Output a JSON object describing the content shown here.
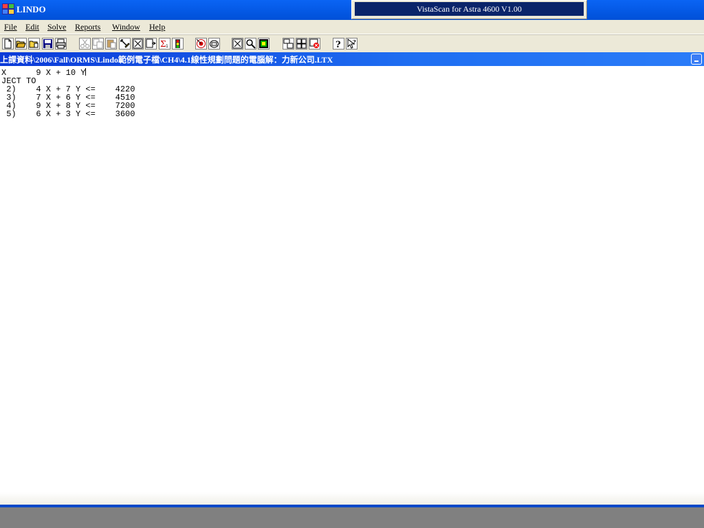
{
  "app": {
    "title": "LINDO"
  },
  "vistascan_window": {
    "title": "VistaScan for Astra 4600 V1.00"
  },
  "menu": [
    {
      "id": "file",
      "label": "File"
    },
    {
      "id": "edit",
      "label": "Edit"
    },
    {
      "id": "solve",
      "label": "Solve"
    },
    {
      "id": "reports",
      "label": "Reports"
    },
    {
      "id": "window",
      "label": "Window"
    },
    {
      "id": "help",
      "label": "Help"
    }
  ],
  "toolbar_icons": [
    "new-file-icon",
    "open-file-icon",
    "view-icon",
    "save-icon",
    "print-icon",
    "cut-icon",
    "copy-icon",
    "paste-icon",
    "clear-icon",
    "find-icon",
    "goto-icon",
    "sum-icon",
    "stop-icon",
    "go-icon",
    "list-icon",
    "options-icon",
    "look-icon",
    "picture-icon",
    "cascade-icon",
    "tile-icon",
    "close-all-icon",
    "help-icon",
    "context-help-icon"
  ],
  "document": {
    "title": "上課資料\\2006\\Fall\\ORMS\\Lindo範例電子檔\\CH4\\4.1線性規劃問題的電腦解：力新公司.LTX",
    "lines": [
      "X      9 X + 10 Y",
      "JECT TO",
      " 2)    4 X + 7 Y <=    4220",
      " 3)    7 X + 6 Y <=    4510",
      " 4)    9 X + 8 Y <=    7200",
      " 5)    6 X + 3 Y <=    3600"
    ]
  }
}
